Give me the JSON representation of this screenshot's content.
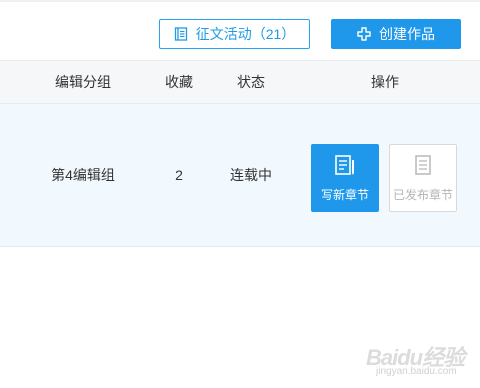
{
  "toolbar": {
    "contest_label": "征文活动（21）",
    "create_label": "创建作品"
  },
  "table": {
    "headers": {
      "group": "编辑分组",
      "favorites": "收藏",
      "status": "状态",
      "actions": "操作"
    },
    "rows": [
      {
        "group": "第4编辑组",
        "favorites": "2",
        "status": "连载中",
        "actions": {
          "write_chapter": "写新章节",
          "published_chapters": "已发布章节"
        }
      }
    ]
  },
  "watermark": {
    "main": "Baidu经验",
    "sub": "jingyan.baidu.com"
  },
  "colors": {
    "primary": "#1f98ec",
    "row_highlight": "#f2f9fe",
    "header_bg": "#f6f7f9"
  },
  "icons": {
    "contest": "book-icon",
    "create": "plus-icon",
    "write": "edit-document-icon",
    "published": "document-icon"
  }
}
